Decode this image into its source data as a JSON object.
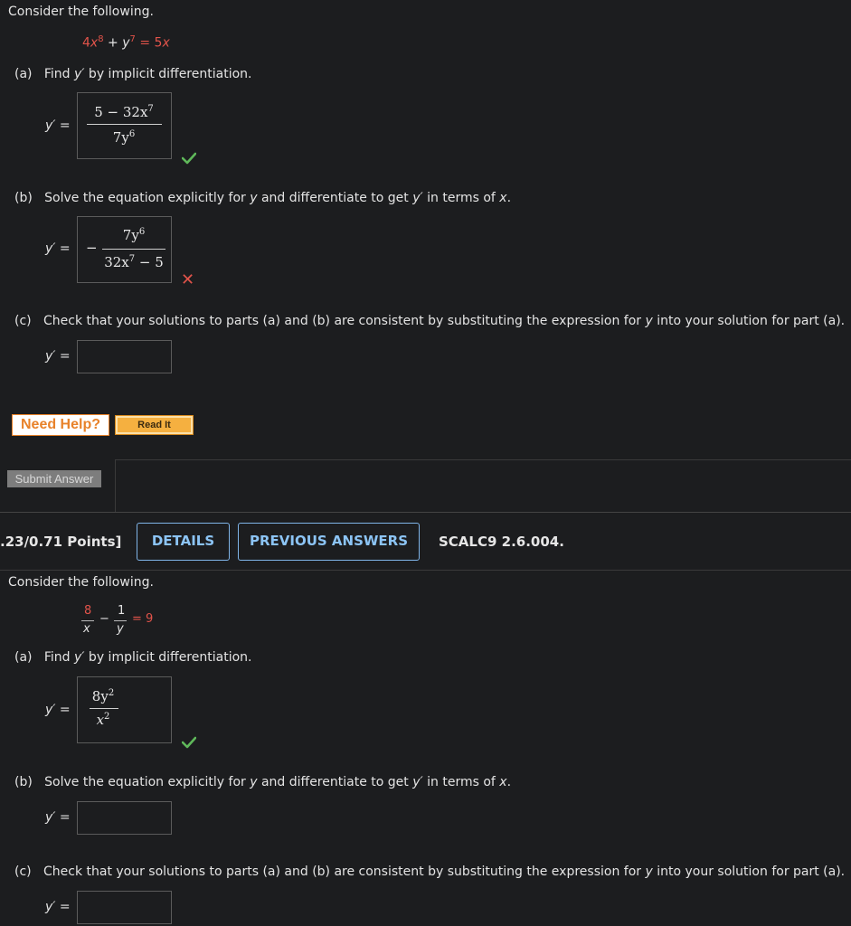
{
  "q1": {
    "intro": "Consider the following.",
    "equation": {
      "t1": "4",
      "x1": "x",
      "e1": "8",
      "plus": " + ",
      "y1": "y",
      "e2": "7",
      "eq": " = 5",
      "x2": "x"
    },
    "a": {
      "label": "(a)",
      "text_pre": "Find ",
      "yprime": "y′",
      "text_post": " by implicit differentiation.",
      "answer_num": "5 − 32x",
      "answer_num_exp": "7",
      "answer_den": "7y",
      "answer_den_exp": "6",
      "status": "correct"
    },
    "b": {
      "label": "(b)",
      "text_1": "Solve the equation explicitly for ",
      "y": "y",
      "text_2": " and differentiate to get ",
      "yprime": "y′",
      "text_3": " in terms of ",
      "x": "x",
      "text_4": ".",
      "minus": "−",
      "answer_num": "7y",
      "answer_num_exp": "6",
      "answer_den": "32x",
      "answer_den_exp": "7",
      "answer_den_tail": " − 5",
      "status": "incorrect"
    },
    "c": {
      "label": "(c)",
      "text_1": "Check that your solutions to parts (a) and (b) are consistent by substituting the expression for ",
      "y": "y",
      "text_2": " into your solution for part (a).",
      "value": ""
    },
    "need_help": "Need Help?",
    "read_it": "Read It",
    "submit": "Submit Answer"
  },
  "q2_header": {
    "points": ".23/0.71 Points]",
    "details": "DETAILS",
    "previous_answers": "PREVIOUS ANSWERS",
    "code": "SCALC9 2.6.004."
  },
  "q2": {
    "intro": "Consider the following.",
    "equation": {
      "n1": "8",
      "d1": "x",
      "minus": "−",
      "n2": "1",
      "d2": "y",
      "eq": "= 9"
    },
    "a": {
      "label": "(a)",
      "text_pre": "Find ",
      "yprime": "y′",
      "text_post": " by implicit differentiation.",
      "answer_num": "8y",
      "answer_num_exp": "2",
      "answer_den": "x",
      "answer_den_exp": "2",
      "status": "correct"
    },
    "b": {
      "label": "(b)",
      "text_1": "Solve the equation explicitly for ",
      "y": "y",
      "text_2": " and differentiate to get ",
      "yprime": "y′",
      "text_3": " in terms of ",
      "x": "x",
      "text_4": ".",
      "value": ""
    },
    "c": {
      "label": "(c)",
      "text_1": "Check that your solutions to parts (a) and (b) are consistent by substituting the expression for ",
      "y": "y",
      "text_2": " into your solution for part (a).",
      "value": ""
    }
  },
  "common": {
    "yprime_label": "y′",
    "equals": " ="
  },
  "colors": {
    "accent": "#8cc4f5",
    "correct": "#5fb85a",
    "incorrect": "#e0534a",
    "help": "#e8822a"
  }
}
